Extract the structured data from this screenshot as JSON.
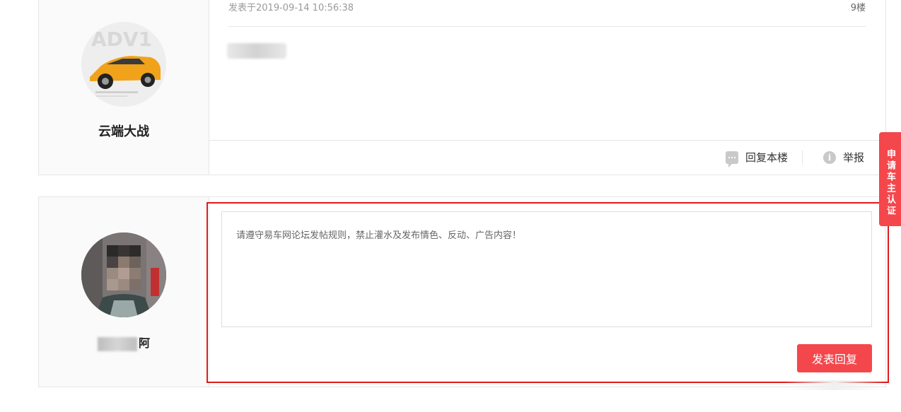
{
  "post": {
    "author": {
      "name": "云端大战",
      "avatar_icon": "sports-car-avatar"
    },
    "timestamp": "发表于2019-09-14 10:56:38",
    "floor": "9楼",
    "content_redacted": true,
    "actions": {
      "reply_label": "回复本楼",
      "report_label": "举报",
      "reply_icon": "comment-icon",
      "report_icon": "info-icon"
    }
  },
  "reply_form": {
    "user": {
      "name_suffix": "阿",
      "avatar_icon": "pixelated-person-avatar"
    },
    "placeholder": "请遵守易车网论坛发帖规则，禁止灌水及发布情色、反动、广告内容！",
    "value": "",
    "submit_label": "发表回复"
  },
  "side_badge": {
    "label": "申请车主认证"
  },
  "colors": {
    "accent": "#f4474c",
    "highlight_border": "#e01a1a",
    "border": "#e6e6e6",
    "author_bg": "#fafafa"
  }
}
